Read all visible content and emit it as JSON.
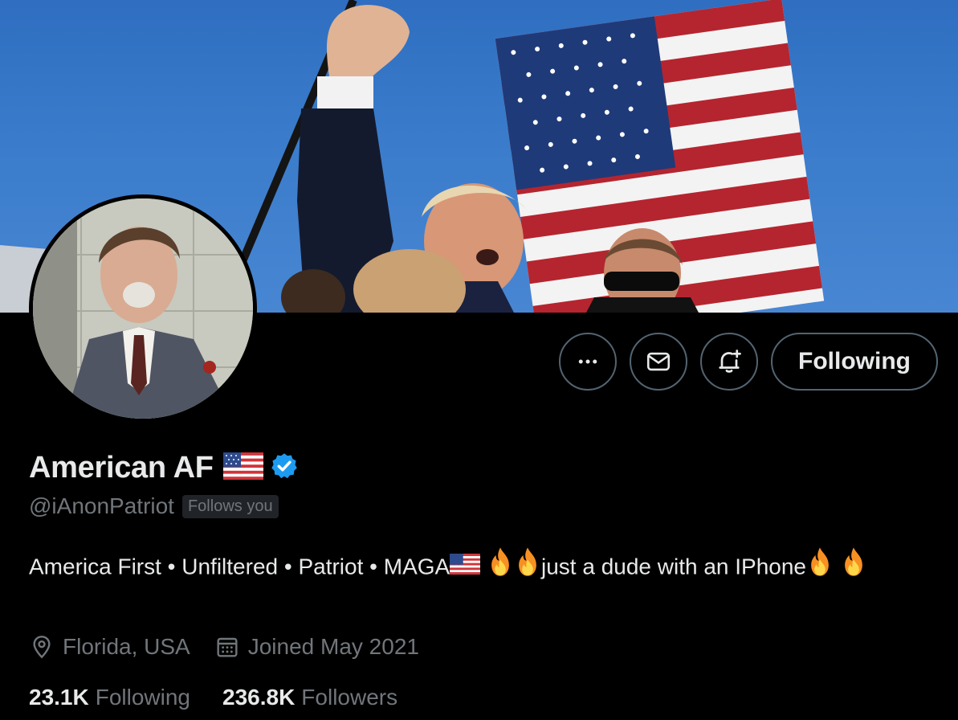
{
  "profile": {
    "display_name": "American AF",
    "handle": "@iAnonPatriot",
    "follows_you": "Follows you",
    "bio": {
      "text1": "America First • Unfiltered • Patriot • MAGA",
      "text2": "just a dude with an IPhone"
    },
    "location": "Florida, USA",
    "joined": "Joined May 2021",
    "following_count": "23.1K",
    "following_label": "Following",
    "followers_count": "236.8K",
    "followers_label": "Followers"
  },
  "actions": {
    "following_button": "Following",
    "more_icon": "more-horizontal-icon",
    "message_icon": "envelope-icon",
    "notify_icon": "bell-plus-icon"
  },
  "colors": {
    "background": "#000000",
    "primary_text": "#e7e9ea",
    "secondary_text": "#71767b",
    "verified_blue": "#1d9bf0",
    "button_border": "#536471"
  }
}
